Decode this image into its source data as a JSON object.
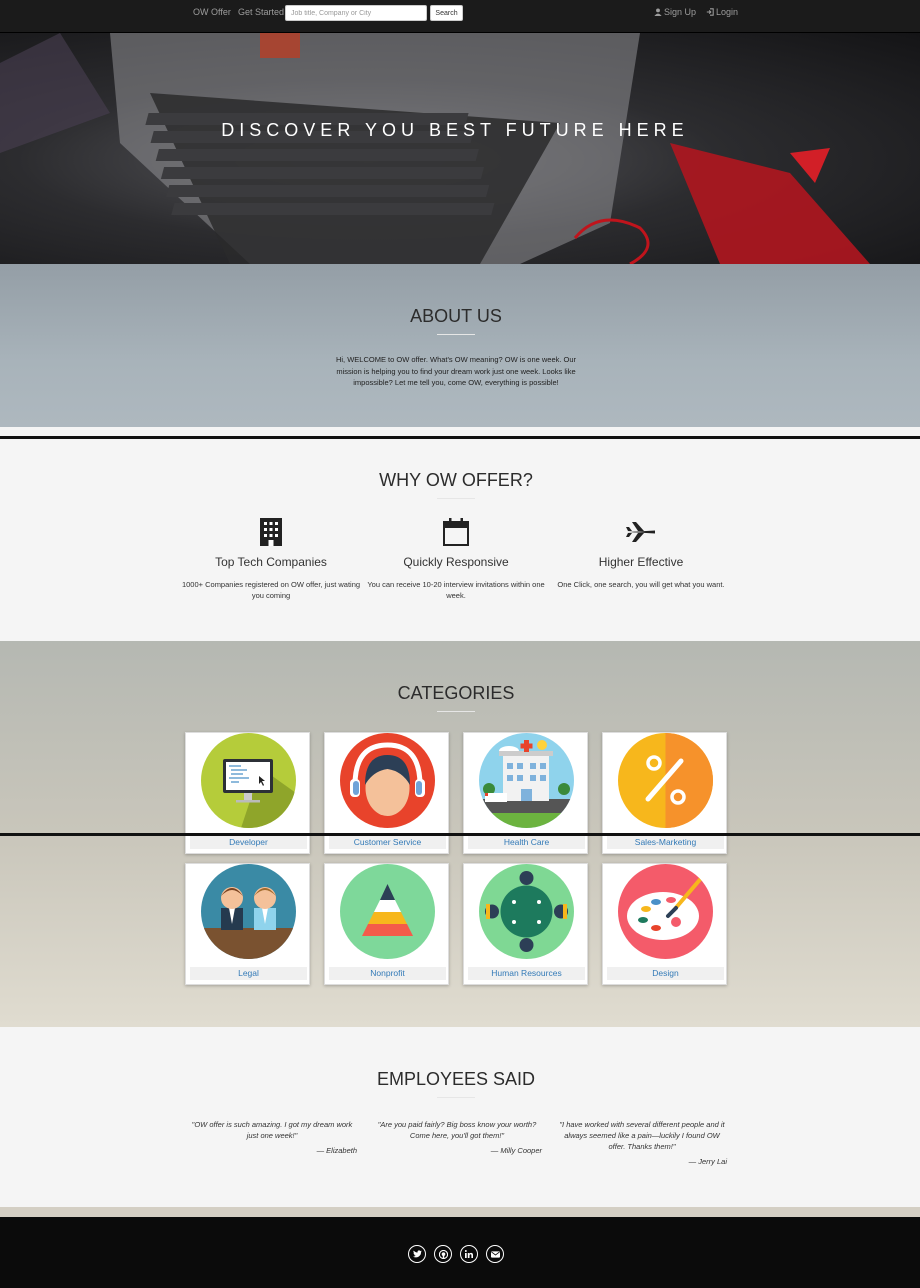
{
  "navbar": {
    "brand": "OW Offer",
    "get_started": "Get Started",
    "search_placeholder": "Job title, Company or City",
    "search_button": "Search",
    "signup": "Sign Up",
    "login": "Login"
  },
  "hero": {
    "title": "DISCOVER YOU BEST FUTURE HERE"
  },
  "about": {
    "title": "ABOUT US",
    "text": "Hi, WELCOME to OW offer. What's OW meaning? OW is one week. Our mission is helping you to find your dream work just one week. Looks like impossible? Let me tell you, come OW, everything is possible!"
  },
  "why": {
    "title": "WHY OW OFFER?",
    "features": [
      {
        "icon": "building-icon",
        "title": "Top Tech Companies",
        "text": "1000+ Companies registered on OW offer, just wating you coming"
      },
      {
        "icon": "calendar-icon",
        "title": "Quickly Responsive",
        "text": "You can receive 10-20 interview invitations within one week."
      },
      {
        "icon": "plane-icon",
        "title": "Higher Effective",
        "text": "One Click, one search, you will get what you want."
      }
    ]
  },
  "categories": {
    "title": "CATEGORIES",
    "items": [
      {
        "label": "Developer",
        "color": "#b5cc3a"
      },
      {
        "label": "Customer Service",
        "color": "#e8432b"
      },
      {
        "label": "Health Care",
        "color": "#8fd3ec"
      },
      {
        "label": "Sales-Marketing",
        "color": "#f7b71c"
      },
      {
        "label": "Legal",
        "color": "#3a8aa5"
      },
      {
        "label": "Nonprofit",
        "color": "#7ed89a"
      },
      {
        "label": "Human Resources",
        "color": "#7fd894"
      },
      {
        "label": "Design",
        "color": "#f45b6a"
      }
    ]
  },
  "employees": {
    "title": "EMPLOYEES SAID",
    "quotes": [
      {
        "text": "\"OW offer is such amazing. I got my dream work just one week!\"",
        "author": "— Elizabeth"
      },
      {
        "text": "\"Are you paid fairly? Big boss know your worth? Come here, you'll got them!\"",
        "author": "— Milly Cooper"
      },
      {
        "text": "\"I have worked with several different people and it always seemed like a pain—luckily I found OW offer. Thanks them!\"",
        "author": "— Jerry Lai"
      }
    ]
  },
  "footer": {
    "social": [
      "twitter-icon",
      "github-icon",
      "linkedin-icon",
      "email-icon"
    ]
  }
}
